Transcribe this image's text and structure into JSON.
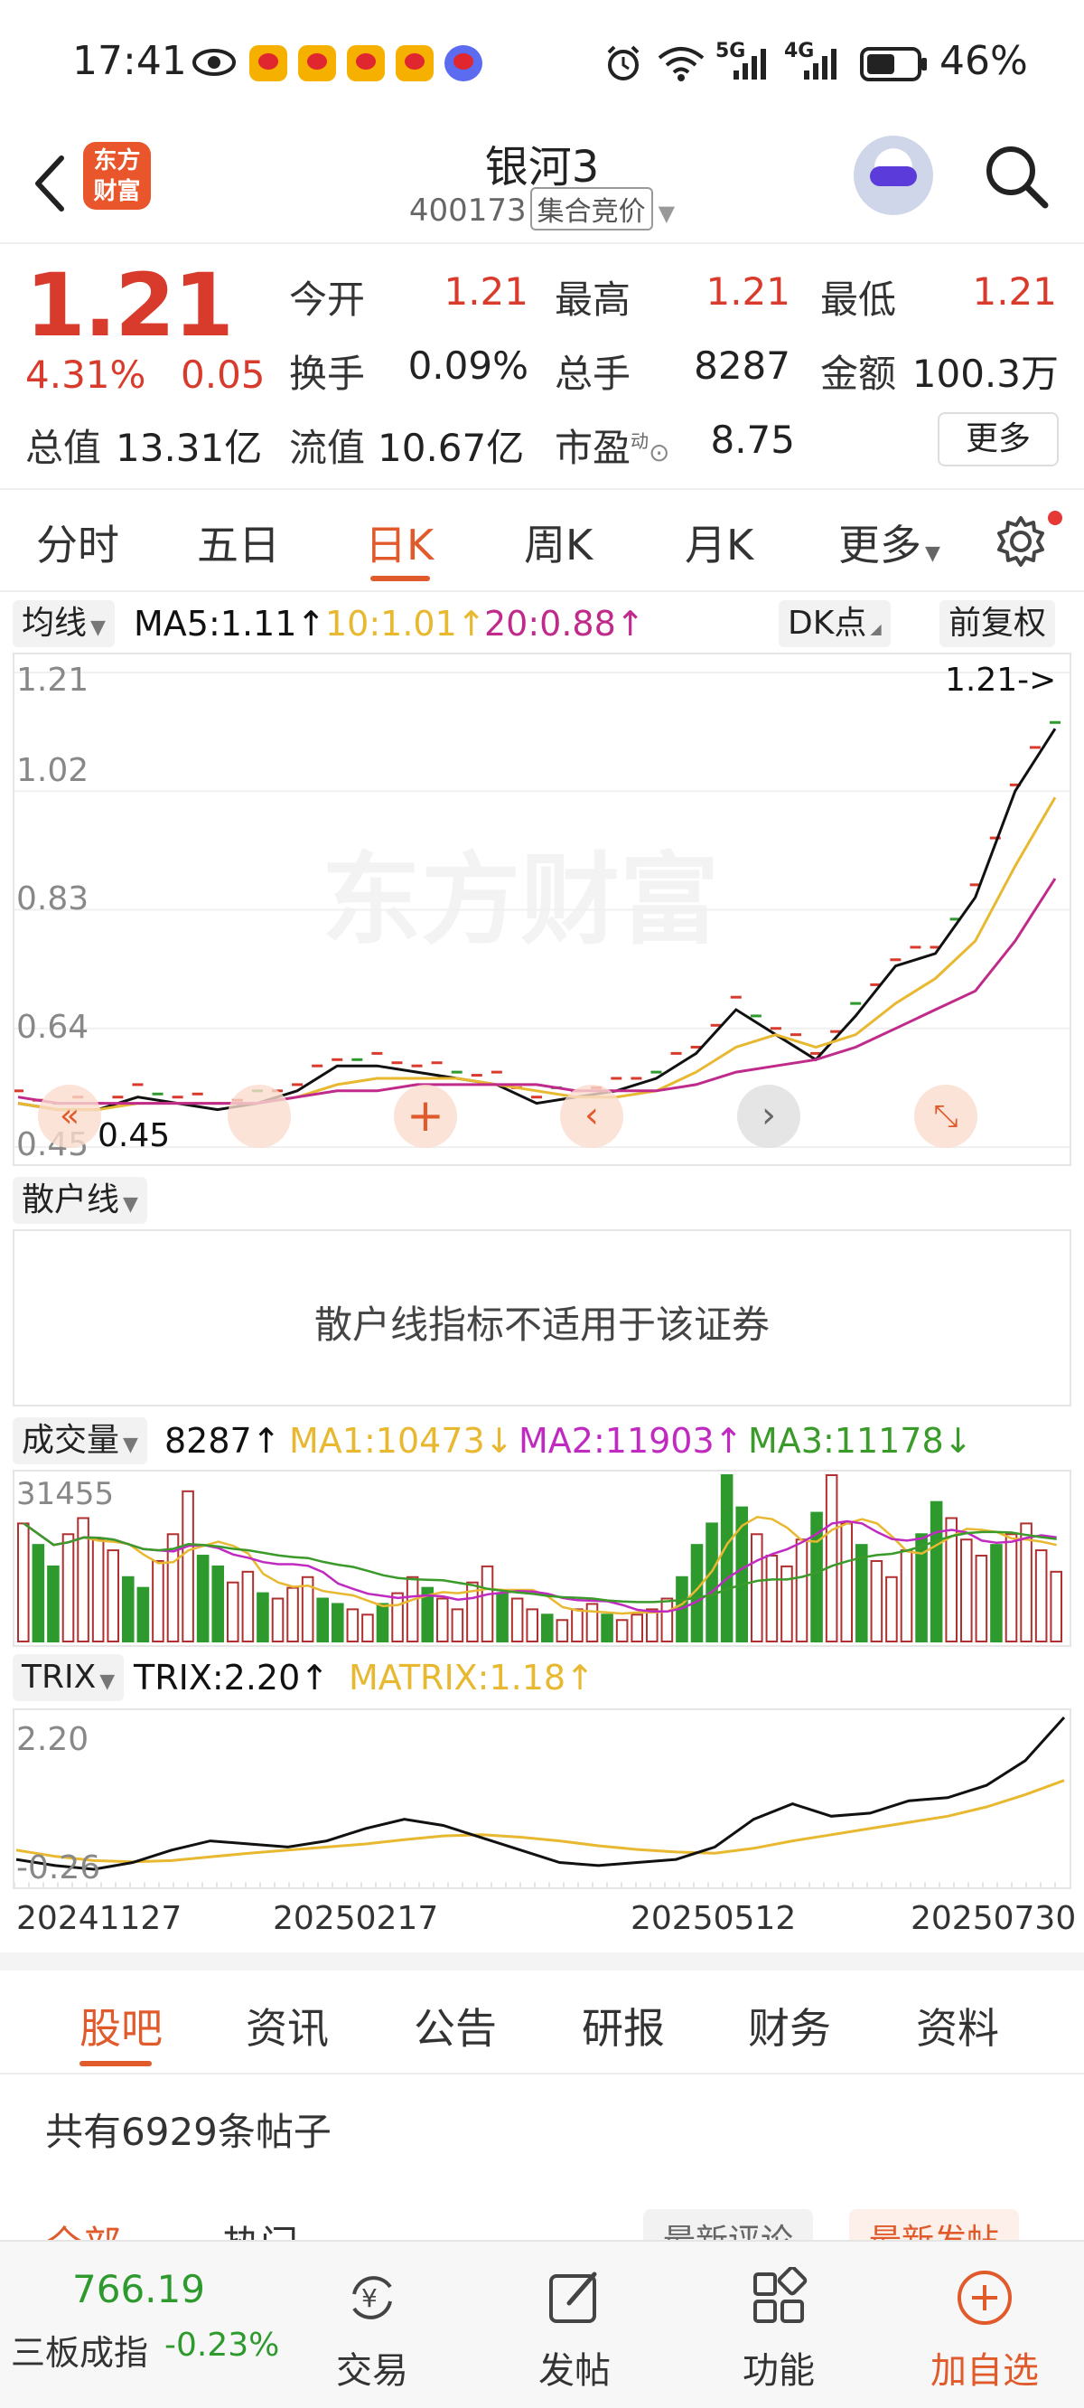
{
  "status_bar": {
    "time": "17:41",
    "battery": "46%",
    "network_labels": [
      "5G",
      "4G"
    ],
    "icons": [
      "eye-icon",
      "weibo-icon",
      "weibo-icon",
      "weibo-icon",
      "weibo-icon",
      "music-icon",
      "alarm-icon",
      "wifi-icon",
      "signal-icon",
      "signal-icon",
      "battery-icon"
    ]
  },
  "header": {
    "brand_logo": "东方\n财富",
    "stock_name": "银河3",
    "stock_code": "400173",
    "auction_tag": "集合竞价"
  },
  "quote": {
    "price": "1.21",
    "change_pct": "4.31%",
    "change_abs": "0.05",
    "open_label": "今开",
    "open": "1.21",
    "high_label": "最高",
    "high": "1.21",
    "low_label": "最低",
    "low": "1.21",
    "turnover_label": "换手",
    "turnover": "0.09%",
    "volume_label": "总手",
    "volume": "8287",
    "amount_label": "金额",
    "amount": "100.3万",
    "mktcap_label": "总值",
    "mktcap": "13.31亿",
    "float_label": "流值",
    "float": "10.67亿",
    "pe_label": "市盈",
    "pe_sup": "动",
    "pe": "8.75",
    "more_label": "更多"
  },
  "period_tabs": [
    "分时",
    "五日",
    "日K",
    "周K",
    "月K",
    "更多"
  ],
  "period_active": "日K",
  "ma": {
    "selector": "均线",
    "ma5": "MA5:1.11↑",
    "ma10": "10:1.01↑",
    "ma20": "20:0.88↑",
    "dk_label": "DK点",
    "fq_label": "前复权"
  },
  "kline": {
    "y_ticks": [
      "1.21",
      "1.02",
      "0.83",
      "0.64",
      "0.45"
    ],
    "last_price_marker": "1.21->",
    "low_marker": "0.45",
    "watermark": "东方财富"
  },
  "retail": {
    "selector": "散户线",
    "message": "散户线指标不适用于该证券"
  },
  "volume": {
    "selector": "成交量",
    "value": "8287↑",
    "ma1": "MA1:10473↓",
    "ma2": "MA2:11903↑",
    "ma3": "MA3:11178↓",
    "y_top": "31455"
  },
  "trix": {
    "selector": "TRIX",
    "trix": "TRIX:2.20↑",
    "matrix": "MATRIX:1.18↑",
    "y_top": "2.20",
    "y_bottom": "-0.26"
  },
  "dates": [
    "20241127",
    "20250217",
    "20250512",
    "20250730"
  ],
  "content_tabs": [
    "股吧",
    "资讯",
    "公告",
    "研报",
    "财务",
    "资料"
  ],
  "content_active": "股吧",
  "post_count": "共有6929条帖子",
  "sub_tabs": [
    "全部",
    "热门"
  ],
  "sort_buttons": [
    "最新评论",
    "最新发帖"
  ],
  "bottom_bar": {
    "index_value": "766.19",
    "index_name": "三板成指",
    "index_change": "-0.23%",
    "trade": "交易",
    "post": "发帖",
    "functions": "功能",
    "add_watch": "加自选"
  },
  "colors": {
    "up": "#d83a2c",
    "accent": "#e05a2b",
    "ma5": "#111111",
    "ma10": "#e8b830",
    "ma20": "#c02a8a",
    "ma3_green": "#3a9a2a",
    "down": "#2e9a2e"
  },
  "chart_data": {
    "type": "candlestick",
    "ylim": [
      0.45,
      1.21
    ],
    "x_labels": [
      "20241127",
      "20250217",
      "20250512",
      "20250730"
    ],
    "series": [
      {
        "name": "MA5",
        "values": [
          0.52,
          0.51,
          0.51,
          0.53,
          0.52,
          0.51,
          0.52,
          0.54,
          0.58,
          0.58,
          0.57,
          0.56,
          0.55,
          0.52,
          0.53,
          0.54,
          0.56,
          0.6,
          0.67,
          0.63,
          0.59,
          0.66,
          0.74,
          0.76,
          0.85,
          1.02,
          1.12
        ]
      },
      {
        "name": "10",
        "values": [
          0.52,
          0.51,
          0.51,
          0.52,
          0.52,
          0.52,
          0.52,
          0.53,
          0.55,
          0.56,
          0.56,
          0.56,
          0.55,
          0.54,
          0.53,
          0.53,
          0.54,
          0.57,
          0.61,
          0.63,
          0.61,
          0.63,
          0.68,
          0.72,
          0.78,
          0.9,
          1.01
        ]
      },
      {
        "name": "20",
        "values": [
          0.53,
          0.52,
          0.52,
          0.52,
          0.52,
          0.52,
          0.52,
          0.53,
          0.54,
          0.54,
          0.55,
          0.55,
          0.55,
          0.55,
          0.54,
          0.54,
          0.54,
          0.55,
          0.57,
          0.58,
          0.59,
          0.61,
          0.64,
          0.67,
          0.7,
          0.78,
          0.88
        ]
      }
    ],
    "volume": {
      "ylim": [
        0,
        31455
      ],
      "bars": [
        22,
        18,
        14,
        20,
        23,
        19,
        17,
        12,
        10,
        15,
        20,
        28,
        16,
        14,
        11,
        13,
        9,
        8,
        10,
        12,
        8,
        7,
        6,
        5,
        7,
        9,
        12,
        10,
        8,
        6,
        11,
        14,
        9,
        8,
        6,
        5,
        4,
        6,
        7,
        5,
        4,
        5,
        6,
        8,
        12,
        18,
        22,
        31,
        25,
        20,
        16,
        14,
        19,
        24,
        31,
        22,
        18,
        15,
        12,
        17,
        20,
        26,
        23,
        19,
        16,
        18,
        20,
        22,
        17,
        13
      ],
      "down": [
        0,
        1,
        1,
        0,
        0,
        0,
        0,
        1,
        1,
        0,
        0,
        0,
        1,
        1,
        0,
        0,
        1,
        0,
        0,
        0,
        1,
        1,
        0,
        0,
        1,
        0,
        0,
        1,
        0,
        0,
        0,
        0,
        1,
        0,
        0,
        1,
        0,
        0,
        0,
        1,
        0,
        0,
        0,
        0,
        1,
        1,
        1,
        1,
        1,
        0,
        0,
        0,
        0,
        1,
        0,
        0,
        1,
        0,
        0,
        0,
        1,
        1,
        0,
        0,
        0,
        1,
        0,
        0,
        0,
        0
      ]
    },
    "trix": {
      "trix_values": [
        -0.1,
        -0.2,
        -0.26,
        -0.15,
        0.05,
        0.2,
        0.15,
        0.1,
        0.2,
        0.4,
        0.55,
        0.45,
        0.25,
        0.05,
        -0.15,
        -0.2,
        -0.15,
        -0.1,
        0.1,
        0.55,
        0.8,
        0.6,
        0.65,
        0.85,
        0.9,
        1.1,
        1.5,
        2.2
      ],
      "matrix_values": [
        0.05,
        -0.05,
        -0.12,
        -0.14,
        -0.12,
        -0.06,
        0.0,
        0.05,
        0.1,
        0.15,
        0.22,
        0.28,
        0.3,
        0.26,
        0.2,
        0.12,
        0.06,
        0.02,
        0.0,
        0.08,
        0.2,
        0.3,
        0.4,
        0.5,
        0.6,
        0.75,
        0.95,
        1.18
      ]
    }
  }
}
